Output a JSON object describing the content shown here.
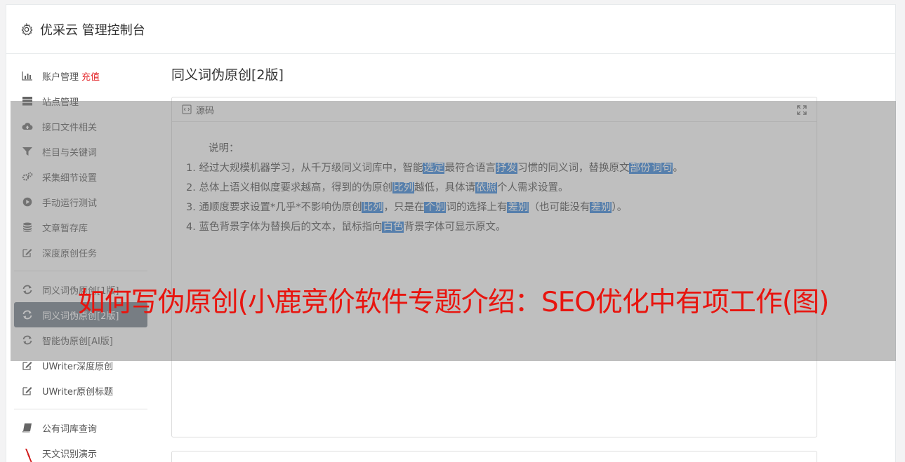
{
  "header": {
    "title": "优采云 管理控制台"
  },
  "sidebar": {
    "items": [
      {
        "label": "账户管理",
        "badge": "充值",
        "icon": "bar-chart-icon"
      },
      {
        "label": "站点管理",
        "icon": "server-icon"
      },
      {
        "label": "接口文件相关",
        "icon": "cloud-upload-icon"
      },
      {
        "label": "栏目与关键词",
        "icon": "filter-icon"
      },
      {
        "label": "采集细节设置",
        "icon": "gears-icon"
      },
      {
        "label": "手动运行测试",
        "icon": "play-circle-icon"
      },
      {
        "label": "文章暂存库",
        "icon": "database-icon"
      },
      {
        "label": "深度原创任务",
        "icon": "edit-icon"
      },
      {
        "label": "同义词伪原创[1版]",
        "icon": "refresh-icon"
      },
      {
        "label": "同义词伪原创[2版]",
        "icon": "refresh-icon",
        "active": true
      },
      {
        "label": "智能伪原创[AI版]",
        "icon": "refresh-icon"
      },
      {
        "label": "UWriter深度原创",
        "icon": "edit-icon"
      },
      {
        "label": "UWriter原创标题",
        "icon": "edit-icon"
      },
      {
        "label": "公有词库查询",
        "icon": "book-icon"
      },
      {
        "label": "天文识别演示",
        "icon": "red-mark-icon"
      }
    ]
  },
  "main": {
    "title": "同义词伪原创[2版]",
    "editor": {
      "tab_label": "源码",
      "heading": "说明：",
      "lines": [
        {
          "parts": [
            "1. 经过大规模机器学习，从千万级同义词库中，智能",
            {
              "hl": "选定"
            },
            "最符合语言",
            {
              "hl": "抒发"
            },
            "习惯的同义词，替换原文",
            {
              "hl": "部份"
            },
            {
              "hl": "词句"
            },
            "。"
          ]
        },
        {
          "parts": [
            "2. 总体上语义相似度要求越高，得到的伪原创",
            {
              "hl": "比列"
            },
            "越低，具体请",
            {
              "hl": "依照"
            },
            "个人需求设置。"
          ]
        },
        {
          "parts": [
            "3. 通顺度要求设置*几乎*不影响伪原创",
            {
              "hl": "比列"
            },
            "，只是在",
            {
              "hl": "个别"
            },
            "词的选择上有",
            {
              "hl": "差别"
            },
            "（也可能没有",
            {
              "hl": "差别"
            },
            "）。"
          ]
        },
        {
          "parts": [
            "4. 蓝色背景字体为替换后的文本，鼠标指向",
            {
              "hl": "白色"
            },
            "背景字体可显示原文。"
          ]
        }
      ]
    }
  },
  "overlay": {
    "banner": "如何写伪原创(小鹿竞价软件专题介绍：SEO优化中有项工作(图)"
  },
  "colors": {
    "highlight": "#2d7fd8",
    "recharge": "#e4262a",
    "active_nav": "#6f7a87",
    "banner": "#e8150f"
  }
}
